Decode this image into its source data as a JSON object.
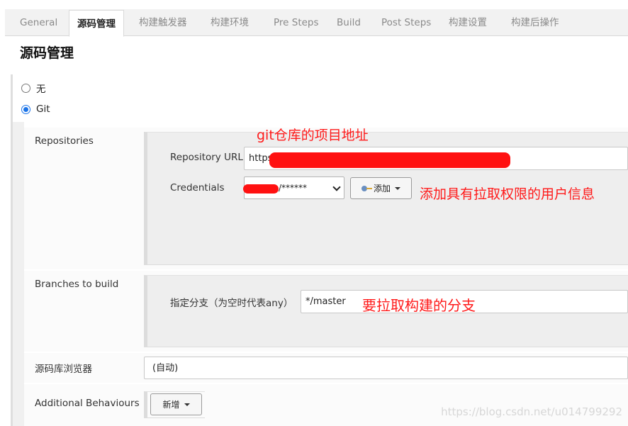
{
  "tabs": [
    {
      "label": "General",
      "active": false
    },
    {
      "label": "源码管理",
      "active": true
    },
    {
      "label": "构建触发器",
      "active": false
    },
    {
      "label": "构建环境",
      "active": false
    },
    {
      "label": "Pre Steps",
      "active": false
    },
    {
      "label": "Build",
      "active": false
    },
    {
      "label": "Post Steps",
      "active": false
    },
    {
      "label": "构建设置",
      "active": false
    },
    {
      "label": "构建后操作",
      "active": false
    }
  ],
  "section_title": "源码管理",
  "scm_options": [
    {
      "label": "无",
      "checked": false
    },
    {
      "label": "Git",
      "checked": true
    }
  ],
  "repositories": {
    "label": "Repositories",
    "url_label": "Repository URL",
    "url_value": "https",
    "credentials_label": "Credentials",
    "credentials_value": "/******",
    "add_button": "添加"
  },
  "branches": {
    "label": "Branches to build",
    "branch_label": "指定分支（为空时代表any）",
    "branch_value": "*/master"
  },
  "browser": {
    "label": "源码库浏览器",
    "value": "(自动)"
  },
  "behaviours": {
    "label": "Additional Behaviours",
    "add_button": "新增"
  },
  "annotations": {
    "repo_url_note": "git仓库的项目地址",
    "credentials_note": "添加具有拉取权限的用户信息",
    "branch_note": "要拉取构建的分支"
  },
  "watermark": "https://blog.csdn.net/u014799292",
  "colors": {
    "annotation": "#ff1a1a",
    "radio_checked": "#1a73e8"
  },
  "icons": {
    "credentials_add": "key-icon",
    "dropdown": "caret-down-icon"
  }
}
